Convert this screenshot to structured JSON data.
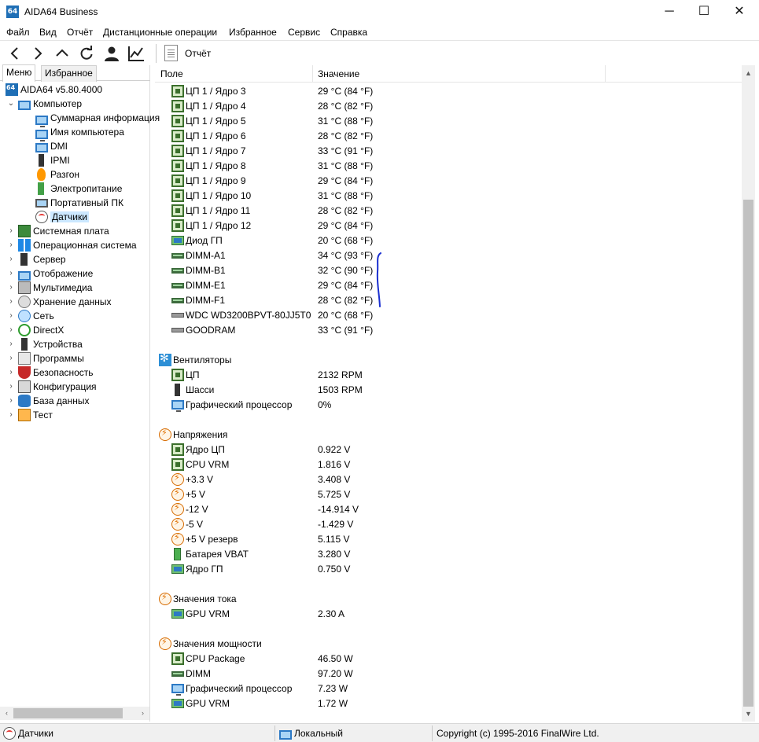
{
  "window": {
    "app_icon_text": "64",
    "title": "AIDA64 Business",
    "minimize_glyph": "─",
    "maximize_glyph": "☐",
    "close_glyph": "✕"
  },
  "menu": [
    "Файл",
    "Вид",
    "Отчёт",
    "Дистанционные операции",
    "Избранное",
    "Сервис",
    "Справка"
  ],
  "toolbar": {
    "buttons": [
      "back-icon",
      "forward-icon",
      "up-icon",
      "refresh-icon",
      "user-icon",
      "chart-icon"
    ],
    "report_label": "Отчёт"
  },
  "left_panel": {
    "tabs": [
      "Меню",
      "Избранное"
    ],
    "active_tab": "Меню",
    "tree": [
      {
        "label": "AIDA64 v5.80.4000",
        "icon": "aida64-icon",
        "level": 0,
        "expander": ""
      },
      {
        "label": "Компьютер",
        "icon": "computer-icon",
        "level": 0,
        "expander": "⌄"
      },
      {
        "label": "Суммарная информация",
        "icon": "summary-monitor-icon",
        "level": 1,
        "expander": ""
      },
      {
        "label": "Имя компьютера",
        "icon": "computer-name-icon",
        "level": 1,
        "expander": ""
      },
      {
        "label": "DMI",
        "icon": "dmi-icon",
        "level": 1,
        "expander": ""
      },
      {
        "label": "IPMI",
        "icon": "ipmi-icon",
        "level": 1,
        "expander": ""
      },
      {
        "label": "Разгон",
        "icon": "overclock-flame-icon",
        "level": 1,
        "expander": ""
      },
      {
        "label": "Электропитание",
        "icon": "power-icon",
        "level": 1,
        "expander": ""
      },
      {
        "label": "Портативный ПК",
        "icon": "laptop-icon",
        "level": 1,
        "expander": ""
      },
      {
        "label": "Датчики",
        "icon": "sensor-gauge-icon",
        "level": 1,
        "expander": "",
        "selected": true
      },
      {
        "label": "Системная плата",
        "icon": "motherboard-icon",
        "level": 0,
        "expander": "›"
      },
      {
        "label": "Операционная система",
        "icon": "windows-icon",
        "level": 0,
        "expander": "›"
      },
      {
        "label": "Сервер",
        "icon": "server-icon",
        "level": 0,
        "expander": "›"
      },
      {
        "label": "Отображение",
        "icon": "display-icon",
        "level": 0,
        "expander": "›"
      },
      {
        "label": "Мультимедиа",
        "icon": "multimedia-icon",
        "level": 0,
        "expander": "›"
      },
      {
        "label": "Хранение данных",
        "icon": "storage-icon",
        "level": 0,
        "expander": "›"
      },
      {
        "label": "Сеть",
        "icon": "network-icon",
        "level": 0,
        "expander": "›"
      },
      {
        "label": "DirectX",
        "icon": "directx-icon",
        "level": 0,
        "expander": "›"
      },
      {
        "label": "Устройства",
        "icon": "devices-icon",
        "level": 0,
        "expander": "›"
      },
      {
        "label": "Программы",
        "icon": "programs-icon",
        "level": 0,
        "expander": "›"
      },
      {
        "label": "Безопасность",
        "icon": "security-shield-icon",
        "level": 0,
        "expander": "›"
      },
      {
        "label": "Конфигурация",
        "icon": "configuration-icon",
        "level": 0,
        "expander": "›"
      },
      {
        "label": "База данных",
        "icon": "database-icon",
        "level": 0,
        "expander": "›"
      },
      {
        "label": "Тест",
        "icon": "benchmark-icon",
        "level": 0,
        "expander": "›"
      }
    ]
  },
  "columns": {
    "field": "Поле",
    "value": "Значение"
  },
  "rows": [
    {
      "type": "item",
      "icon": "cpu-chip-icon",
      "field": "ЦП 1 / Ядро 3",
      "value": "29 °C  (84 °F)"
    },
    {
      "type": "item",
      "icon": "cpu-chip-icon",
      "field": "ЦП 1 / Ядро 4",
      "value": "28 °C  (82 °F)"
    },
    {
      "type": "item",
      "icon": "cpu-chip-icon",
      "field": "ЦП 1 / Ядро 5",
      "value": "31 °C  (88 °F)"
    },
    {
      "type": "item",
      "icon": "cpu-chip-icon",
      "field": "ЦП 1 / Ядро 6",
      "value": "28 °C  (82 °F)"
    },
    {
      "type": "item",
      "icon": "cpu-chip-icon",
      "field": "ЦП 1 / Ядро 7",
      "value": "33 °C  (91 °F)"
    },
    {
      "type": "item",
      "icon": "cpu-chip-icon",
      "field": "ЦП 1 / Ядро 8",
      "value": "31 °C  (88 °F)"
    },
    {
      "type": "item",
      "icon": "cpu-chip-icon",
      "field": "ЦП 1 / Ядро 9",
      "value": "29 °C  (84 °F)"
    },
    {
      "type": "item",
      "icon": "cpu-chip-icon",
      "field": "ЦП 1 / Ядро 10",
      "value": "31 °C  (88 °F)"
    },
    {
      "type": "item",
      "icon": "cpu-chip-icon",
      "field": "ЦП 1 / Ядро 11",
      "value": "28 °C  (82 °F)"
    },
    {
      "type": "item",
      "icon": "cpu-chip-icon",
      "field": "ЦП 1 / Ядро 12",
      "value": "29 °C  (84 °F)"
    },
    {
      "type": "item",
      "icon": "gpu-card-icon",
      "field": "Диод ГП",
      "value": "20 °C  (68 °F)"
    },
    {
      "type": "item",
      "icon": "dimm-module-icon",
      "field": "DIMM-A1",
      "value": "34 °C  (93 °F)"
    },
    {
      "type": "item",
      "icon": "dimm-module-icon",
      "field": "DIMM-B1",
      "value": "32 °C  (90 °F)"
    },
    {
      "type": "item",
      "icon": "dimm-module-icon",
      "field": "DIMM-E1",
      "value": "29 °C  (84 °F)"
    },
    {
      "type": "item",
      "icon": "dimm-module-icon",
      "field": "DIMM-F1",
      "value": "28 °C  (82 °F)"
    },
    {
      "type": "item",
      "icon": "hard-drive-icon",
      "field": "WDC WD3200BPVT-80JJ5T0",
      "value": "20 °C  (68 °F)"
    },
    {
      "type": "item",
      "icon": "hard-drive-icon",
      "field": "GOODRAM",
      "value": "33 °C  (91 °F)"
    },
    {
      "type": "blank"
    },
    {
      "type": "group",
      "icon": "fan-icon",
      "field": "Вентиляторы"
    },
    {
      "type": "item",
      "icon": "cpu-chip-icon",
      "field": "ЦП",
      "value": "2132 RPM"
    },
    {
      "type": "item",
      "icon": "chassis-tower-icon",
      "field": "Шасси",
      "value": "1503 RPM"
    },
    {
      "type": "item",
      "icon": "gpu-monitor-icon",
      "field": "Графический процессор",
      "value": "0%"
    },
    {
      "type": "blank"
    },
    {
      "type": "group",
      "icon": "voltage-icon",
      "field": "Напряжения"
    },
    {
      "type": "item",
      "icon": "cpu-chip-icon",
      "field": "Ядро ЦП",
      "value": "0.922 V"
    },
    {
      "type": "item",
      "icon": "cpu-chip-icon",
      "field": "CPU VRM",
      "value": "1.816 V"
    },
    {
      "type": "item",
      "icon": "voltage-icon",
      "field": "+3.3 V",
      "value": "3.408 V"
    },
    {
      "type": "item",
      "icon": "voltage-icon",
      "field": "+5 V",
      "value": "5.725 V"
    },
    {
      "type": "item",
      "icon": "voltage-icon",
      "field": "-12 V",
      "value": "-14.914 V"
    },
    {
      "type": "item",
      "icon": "voltage-icon",
      "field": "-5 V",
      "value": "-1.429 V"
    },
    {
      "type": "item",
      "icon": "voltage-icon",
      "field": "+5 V резерв",
      "value": "5.115 V"
    },
    {
      "type": "item",
      "icon": "battery-icon",
      "field": "Батарея VBAT",
      "value": "3.280 V"
    },
    {
      "type": "item",
      "icon": "gpu-card-icon",
      "field": "Ядро ГП",
      "value": "0.750 V"
    },
    {
      "type": "blank"
    },
    {
      "type": "group",
      "icon": "voltage-icon",
      "field": "Значения тока"
    },
    {
      "type": "item",
      "icon": "gpu-card-icon",
      "field": "GPU VRM",
      "value": "2.30 A"
    },
    {
      "type": "blank"
    },
    {
      "type": "group",
      "icon": "voltage-icon",
      "field": "Значения мощности"
    },
    {
      "type": "item",
      "icon": "cpu-chip-icon",
      "field": "CPU Package",
      "value": "46.50 W"
    },
    {
      "type": "item",
      "icon": "dimm-module-icon",
      "field": "DIMM",
      "value": "97.20 W"
    },
    {
      "type": "item",
      "icon": "gpu-monitor-icon",
      "field": "Графический процессор",
      "value": "7.23 W"
    },
    {
      "type": "item",
      "icon": "gpu-card-icon",
      "field": "GPU VRM",
      "value": "1.72 W"
    }
  ],
  "statusbar": {
    "left": "Датчики",
    "middle": "Локальный",
    "right": "Copyright (c) 1995-2016 FinalWire Ltd."
  },
  "colors": {
    "selection": "#cce8ff",
    "annotation_ink": "#1a2fd0",
    "app_icon": "#1f6fb6"
  }
}
